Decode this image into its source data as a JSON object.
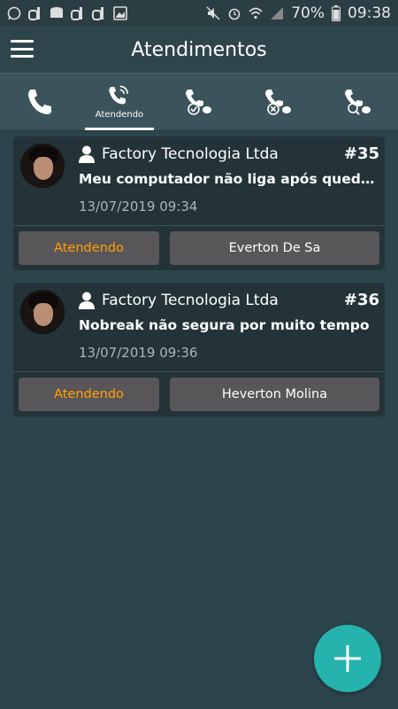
{
  "status_bar": {
    "battery": "70%",
    "time": "09:38"
  },
  "app_bar": {
    "title": "Atendimentos"
  },
  "tabs": [
    {
      "icon": "phone-icon",
      "label": ""
    },
    {
      "icon": "phone-ringing-icon",
      "label": "Atendendo"
    },
    {
      "icon": "phone-check-icon",
      "label": ""
    },
    {
      "icon": "phone-cancel-icon",
      "label": ""
    },
    {
      "icon": "phone-search-icon",
      "label": ""
    }
  ],
  "tickets": [
    {
      "company": "Factory Tecnologia Ltda",
      "number": "#35",
      "subject": "Meu computador não liga após queda de...",
      "date": "13/07/2019 09:34",
      "status": "Atendendo",
      "agent": "Everton De Sa"
    },
    {
      "company": "Factory Tecnologia Ltda",
      "number": "#36",
      "subject": "Nobreak não segura por muito tempo",
      "date": "13/07/2019 09:36",
      "status": "Atendendo",
      "agent": "Heverton Molina"
    }
  ],
  "colors": {
    "accent": "#26b3ad",
    "status_text": "#ffa000"
  }
}
